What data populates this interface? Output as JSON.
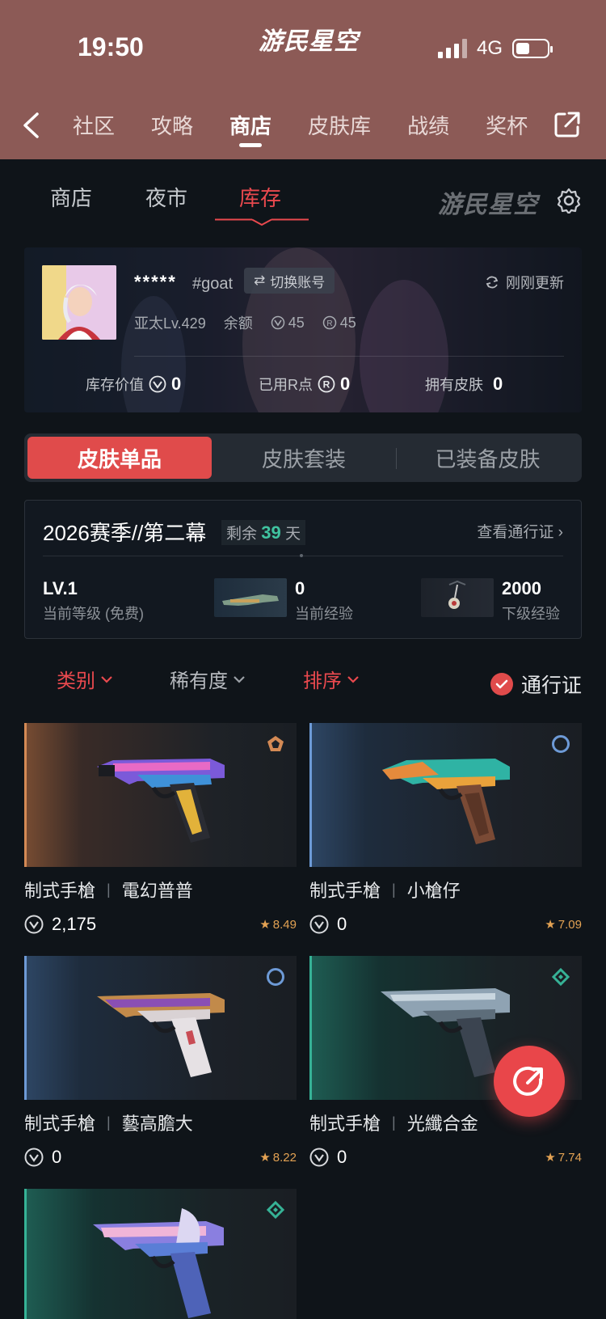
{
  "status": {
    "time": "19:50",
    "network": "4G"
  },
  "header": {
    "logo": "游民星空"
  },
  "nav": {
    "items": [
      "社区",
      "攻略",
      "商店",
      "皮肤库",
      "战绩",
      "奖杯"
    ],
    "active": "商店"
  },
  "subtabs": {
    "items": [
      "商店",
      "夜市",
      "库存"
    ],
    "active": "库存",
    "watermark": "游民星空"
  },
  "profile": {
    "name": "*****",
    "tag": "#goat",
    "switch_label": "切换账号",
    "refresh_label": "刚刚更新",
    "region_level": "亚太Lv.429",
    "balance_label": "余额",
    "vp_balance": "45",
    "rp_balance": "45",
    "stats": {
      "inventory_value_label": "库存价值",
      "inventory_value": "0",
      "used_rp_label": "已用R点",
      "used_rp": "0",
      "owned_skins_label": "拥有皮肤",
      "owned_skins": "0"
    }
  },
  "segment": {
    "items": [
      "皮肤单品",
      "皮肤套装",
      "已装备皮肤"
    ],
    "active": "皮肤单品"
  },
  "season": {
    "title": "2026赛季//第二幕",
    "remain_prefix": "剩余",
    "remain_days": "39",
    "remain_suffix": "天",
    "link": "查看通行证",
    "level_value": "LV.1",
    "level_label": "当前等级 (免费)",
    "current_exp": "0",
    "current_exp_label": "当前经验",
    "next_exp": "2000",
    "next_exp_label": "下级经验"
  },
  "filters": {
    "category": "类别",
    "rarity": "稀有度",
    "sort": "排序",
    "pass": "通行证"
  },
  "cards": [
    {
      "weapon": "制式手槍",
      "skin": "電幻普普",
      "price": "2,175",
      "rating": "8.49",
      "tier": "orange",
      "accent": "#d48a55"
    },
    {
      "weapon": "制式手槍",
      "skin": "小槍仔",
      "price": "0",
      "rating": "7.09",
      "tier": "blue",
      "accent": "#6d9ad6"
    },
    {
      "weapon": "制式手槍",
      "skin": "藝高膽大",
      "price": "0",
      "rating": "8.22",
      "tier": "blue",
      "accent": "#6d9ad6"
    },
    {
      "weapon": "制式手槍",
      "skin": "光纖合金",
      "price": "0",
      "rating": "7.74",
      "tier": "teal",
      "accent": "#36b296"
    },
    {
      "weapon": "",
      "skin": "",
      "price": "",
      "rating": "",
      "tier": "teal",
      "accent": "#36b296"
    }
  ],
  "colors": {
    "accent_red": "#e04b4b",
    "header_bg": "#8c5a56",
    "rating": "#e3a253",
    "teal": "#40c3a0"
  }
}
